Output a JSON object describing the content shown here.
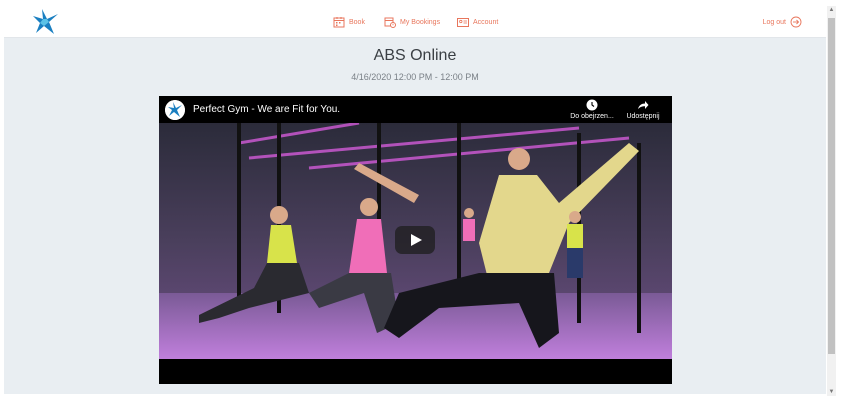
{
  "header": {
    "nav": [
      {
        "label": "Book",
        "icon": "calendar-icon"
      },
      {
        "label": "My Bookings",
        "icon": "bookings-icon"
      },
      {
        "label": "Account",
        "icon": "account-card-icon"
      }
    ],
    "logout_label": "Log out",
    "logout_icon": "logout-arrow-icon",
    "logo_icon": "star-logo-icon"
  },
  "event": {
    "title": "ABS Online",
    "datetime": "4/16/2020 12:00 PM - 12:00 PM"
  },
  "video": {
    "title": "Perfect Gym - We are Fit for You.",
    "watch_later_label": "Do obejrzen...",
    "share_label": "Udostępnij",
    "play_icon": "play-icon"
  },
  "colors": {
    "accent": "#e8765c",
    "brand": "#1a7fc1",
    "background": "#e9eef2"
  }
}
